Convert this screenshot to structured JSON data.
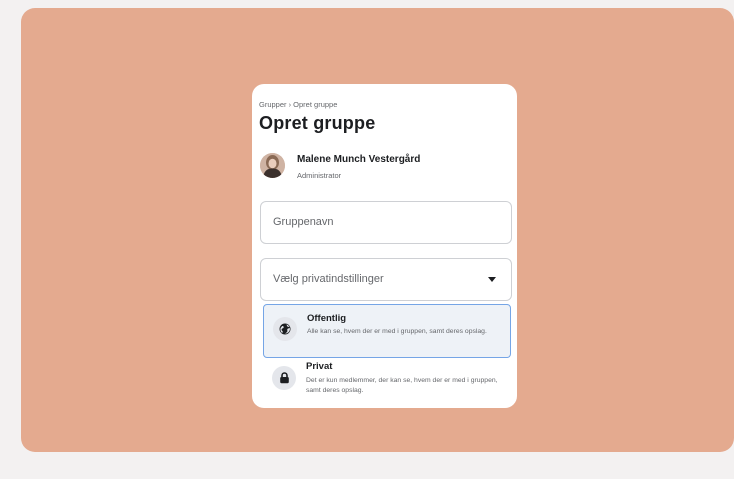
{
  "header": {
    "breadcrumb": "Grupper › Opret gruppe",
    "title": "Opret gruppe"
  },
  "user": {
    "name": "Malene Munch Vestergård",
    "role": "Administrator"
  },
  "form": {
    "group_name_placeholder": "Gruppenavn",
    "privacy_placeholder": "Vælg privatindstillinger"
  },
  "privacy_options": [
    {
      "title": "Offentlig",
      "description": "Alle kan se, hvem der er med i gruppen, samt deres opslag.",
      "icon": "globe-icon",
      "selected": true
    },
    {
      "title": "Privat",
      "description": "Det er kun medlemmer, der kan se, hvem der er med i gruppen, samt deres opslag.",
      "icon": "lock-icon",
      "selected": false
    }
  ],
  "colors": {
    "backdrop": "#e4aa8f",
    "selected_border": "#75a5e6"
  }
}
